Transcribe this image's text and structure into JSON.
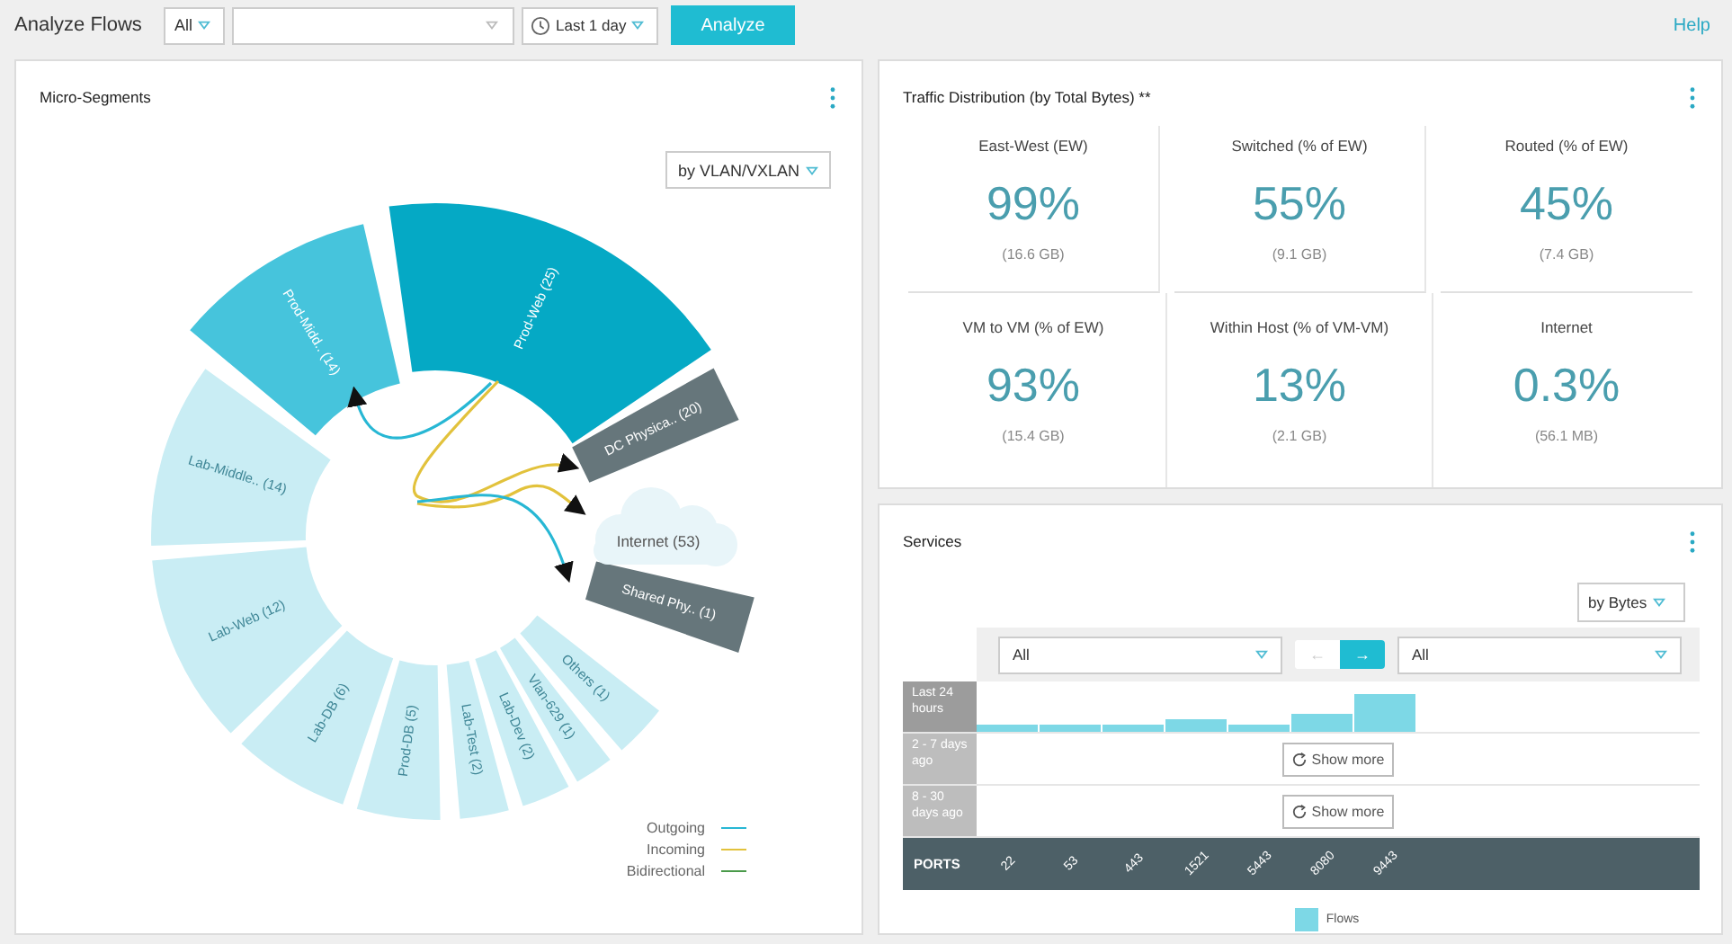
{
  "toolbar": {
    "title": "Analyze Flows",
    "scope_select": "All",
    "time_range": "Last 1 day",
    "analyze_button": "Analyze",
    "help_link": "Help"
  },
  "micro_segments": {
    "title": "Micro-Segments",
    "group_by": "by VLAN/VXLAN",
    "segments": [
      {
        "label": "Prod-Web (25)",
        "kind": "selected",
        "color": "#05a9c5"
      },
      {
        "label": "DC Physica.. (20)",
        "kind": "physical",
        "color": "#66767b"
      },
      {
        "label": "Shared Phy.. (1)",
        "kind": "physical",
        "color": "#66767b"
      },
      {
        "label": "Others (1)",
        "kind": "idle",
        "color": "#c9edf4"
      },
      {
        "label": "Vlan-629 (1)",
        "kind": "idle",
        "color": "#c9edf4"
      },
      {
        "label": "Lab-Dev (2)",
        "kind": "idle",
        "color": "#c9edf4"
      },
      {
        "label": "Lab-Test (2)",
        "kind": "idle",
        "color": "#c9edf4"
      },
      {
        "label": "Prod-DB (5)",
        "kind": "idle",
        "color": "#c9edf4"
      },
      {
        "label": "Lab-DB (6)",
        "kind": "idle",
        "color": "#c9edf4"
      },
      {
        "label": "Lab-Web (12)",
        "kind": "idle",
        "color": "#c9edf4"
      },
      {
        "label": "Lab-Middle.. (14)",
        "kind": "idle",
        "color": "#c9edf4"
      },
      {
        "label": "Prod-Midd.. (14)",
        "kind": "connected",
        "color": "#46c4dc"
      }
    ],
    "internet_node": "Internet (53)",
    "legend": [
      {
        "label": "Outgoing",
        "color": "#27b7d4"
      },
      {
        "label": "Incoming",
        "color": "#e2c23c"
      },
      {
        "label": "Bidirectional",
        "color": "#4a9a4a"
      }
    ]
  },
  "traffic_distribution": {
    "title": "Traffic Distribution (by Total Bytes) **",
    "metrics": [
      {
        "label": "East-West (EW)",
        "value": "99%",
        "detail": "(16.6 GB)"
      },
      {
        "label": "Switched (% of EW)",
        "value": "55%",
        "detail": "(9.1 GB)"
      },
      {
        "label": "Routed (% of EW)",
        "value": "45%",
        "detail": "(7.4 GB)"
      },
      {
        "label": "VM to VM (% of EW)",
        "value": "93%",
        "detail": "(15.4 GB)"
      },
      {
        "label": "Within Host (% of VM-VM)",
        "value": "13%",
        "detail": "(2.1 GB)"
      },
      {
        "label": "Internet",
        "value": "0.3%",
        "detail": "(56.1 MB)"
      }
    ]
  },
  "services": {
    "title": "Services",
    "sort_by": "by Bytes",
    "source_filter": "All",
    "destination_filter": "All",
    "direction_buttons": [
      {
        "label": "←",
        "selected": false
      },
      {
        "label": "→",
        "selected": true
      }
    ],
    "time_rows": [
      {
        "label": "Last 24 hours",
        "kind": "bars"
      },
      {
        "label": "2 - 7 days ago",
        "kind": "show_more",
        "button": "Show more"
      },
      {
        "label": "8 - 30 days ago",
        "kind": "show_more",
        "button": "Show more"
      }
    ],
    "ports_label": "PORTS",
    "ports": [
      "22",
      "53",
      "443",
      "1521",
      "5443",
      "8080",
      "9443"
    ],
    "legend": "Flows"
  }
}
